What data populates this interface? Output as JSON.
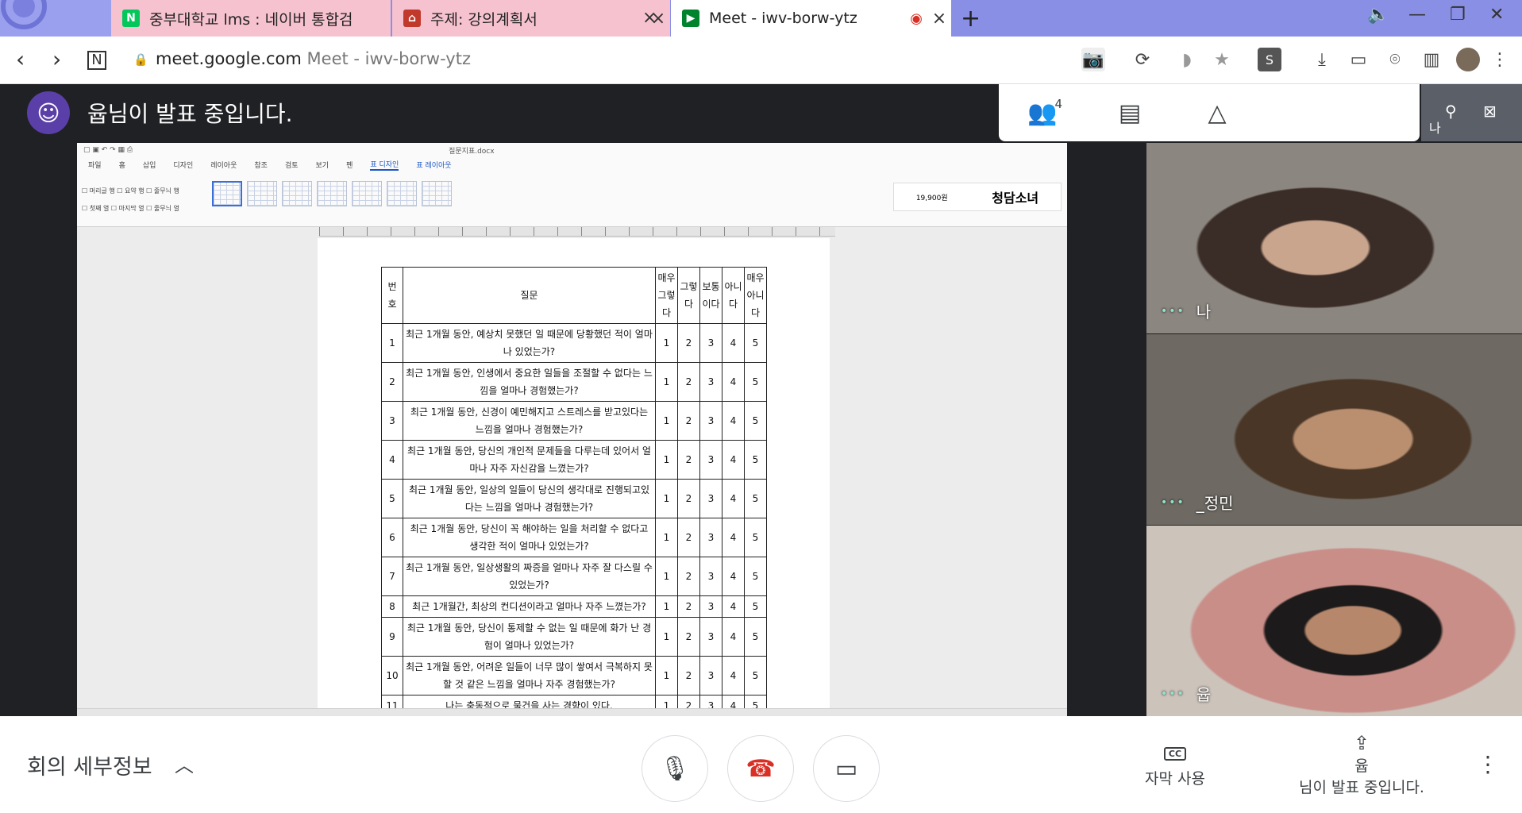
{
  "browser": {
    "tabs": [
      {
        "title": "중부대학교 lms : 네이버 통합검",
        "icon": "naver-icon",
        "favicon_text": "N"
      },
      {
        "title": "주제: 강의계획서",
        "icon": "school-icon",
        "favicon_text": "⌂"
      },
      {
        "title": "Meet - iwv-borw-ytz",
        "icon": "meet-icon",
        "favicon_text": "▶"
      }
    ],
    "new_tab": "+",
    "url_domain": "meet.google.com",
    "url_title": "Meet - iwv-borw-ytz",
    "colors": {
      "tab_inactive": "#f6c2cf",
      "strip": "#8a8fe6"
    }
  },
  "meet": {
    "presenting_banner": "윱님이 발표 중입니다.",
    "people_count": "4",
    "self_tile_name": "나",
    "participants": [
      {
        "name": "나"
      },
      {
        "name": "_정민"
      },
      {
        "name": "윱"
      }
    ],
    "dots": "•••"
  },
  "document": {
    "filename": "질문지표.docx",
    "menus": [
      "파일",
      "홈",
      "삽입",
      "디자인",
      "레이아웃",
      "참조",
      "검토",
      "보기",
      "펜",
      "표 디자인",
      "표 레이아웃"
    ],
    "options": [
      "머리글 행",
      "요약 행",
      "줄무늬 행",
      "첫째 열",
      "마지막 열",
      "줄무늬 열"
    ],
    "ad_price": "19,900원",
    "ad_brand": "청담소녀",
    "table": {
      "headers": [
        "번호",
        "질문",
        "매우 그렇다",
        "그렇다",
        "보통 이다",
        "아니다",
        "매우 아니다"
      ],
      "rows": [
        {
          "n": "1",
          "q": "최근 1개월 동안, 예상치 못했던 일 때문에 당황했던 적이 얼마나 있었는가?"
        },
        {
          "n": "2",
          "q": "최근 1개월 동안, 인생에서 중요한 일들을 조절할 수 없다는 느낌을 얼마나 경험했는가?"
        },
        {
          "n": "3",
          "q": "최근 1개월 동안, 신경이 예민해지고 스트레스를 받고있다는 느낌을 얼마나 경험했는가?"
        },
        {
          "n": "4",
          "q": "최근 1개월 동안, 당신의 개인적 문제들을 다루는데 있어서 얼마나 자주 자신감을 느꼈는가?"
        },
        {
          "n": "5",
          "q": "최근 1개월 동안, 일상의 일들이 당신의 생각대로 진행되고있다는 느낌을 얼마나 경험했는가?"
        },
        {
          "n": "6",
          "q": "최근 1개월 동안, 당신이 꼭 해야하는 일을 처리할 수 없다고 생각한 적이 얼마나 있었는가?"
        },
        {
          "n": "7",
          "q": "최근 1개월 동안, 일상생활의 짜증을 얼마나 자주 잘 다스릴 수 있었는가?"
        },
        {
          "n": "8",
          "q": "최근 1개월간, 최상의 컨디션이라고 얼마나 자주 느꼈는가?"
        },
        {
          "n": "9",
          "q": "최근 1개월 동안, 당신이 통제할 수 없는 일 때문에 화가 난 경험이 얼마나 있었는가?"
        },
        {
          "n": "10",
          "q": "최근 1개월 동안, 어려운 일들이 너무 많이 쌓여서 극복하지 못할 것 같은 느낌을 얼마나 자주 경험했는가?"
        },
        {
          "n": "11",
          "q": "나는 충동적으로 물건을 사는 경향이 있다."
        }
      ],
      "scale": [
        "1",
        "2",
        "3",
        "4",
        "5"
      ]
    }
  },
  "controls": {
    "details": "회의 세부정보",
    "captions_label": "자막 사용",
    "captions_icon_text": "CC",
    "present_name": "윱",
    "present_text": "님이 발표 중입니다."
  }
}
